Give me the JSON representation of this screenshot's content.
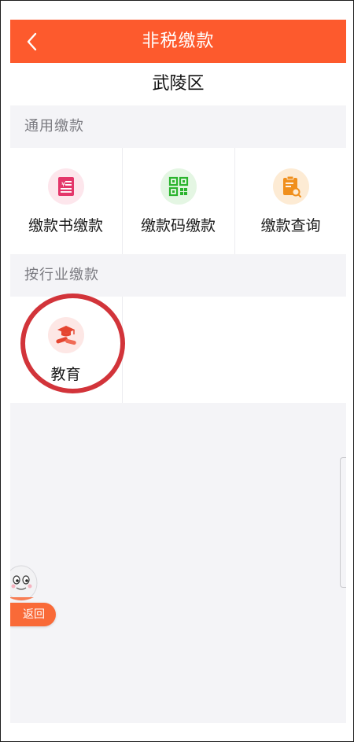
{
  "header": {
    "title": "非税缴款",
    "background_color": "#fd5a2d",
    "back_icon": "chevron-left-icon"
  },
  "region": {
    "name": "武陵区"
  },
  "general_payment": {
    "section_title": "通用缴款",
    "items": [
      {
        "label": "缴款书缴款",
        "icon": "payment-document-icon",
        "icon_bg": "#fde6ec",
        "icon_color": "#e4366a"
      },
      {
        "label": "缴款码缴款",
        "icon": "qr-code-icon",
        "icon_bg": "#e4f6e3",
        "icon_color": "#2bb42e"
      },
      {
        "label": "缴款查询",
        "icon": "query-clipboard-icon",
        "icon_bg": "#fdebd4",
        "icon_color": "#f08f1c"
      }
    ]
  },
  "industry_payment": {
    "section_title": "按行业缴款",
    "items": [
      {
        "label": "教育",
        "icon": "graduation-cap-icon",
        "icon_bg": "#fde7e5",
        "icon_color": "#e54530"
      }
    ]
  },
  "annotation": {
    "highlight_color": "#d2343a"
  },
  "floating": {
    "return_label": "返回",
    "mascot_icon": "mascot-icon",
    "accent_color": "#f96a38"
  }
}
